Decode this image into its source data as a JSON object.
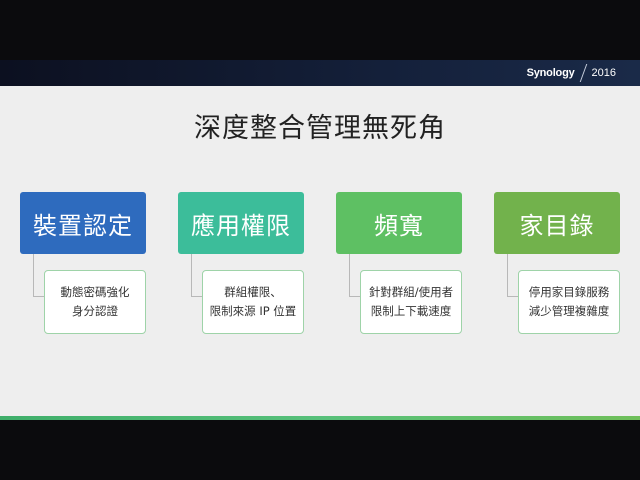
{
  "brand": {
    "name": "Synology",
    "year": "2016"
  },
  "title": "深度整合管理無死角",
  "colors": {
    "blue": "#2e6bbe",
    "teal": "#3cbd9a",
    "green": "#5ec063",
    "olive": "#72b24c",
    "detail_border": "#9ed3a8"
  },
  "categories": [
    {
      "label": "裝置認定",
      "color": "#2e6bbe",
      "details": [
        "動態密碼強化",
        "身分認證"
      ]
    },
    {
      "label": "應用權限",
      "color": "#3cbd9a",
      "details": [
        "群組權限、",
        "限制來源 IP 位置"
      ]
    },
    {
      "label": "頻寬",
      "color": "#5ec063",
      "details": [
        "針對群組/使用者",
        "限制上下載速度"
      ]
    },
    {
      "label": "家目錄",
      "color": "#72b24c",
      "details": [
        "停用家目錄服務",
        "減少管理複雜度"
      ]
    }
  ]
}
